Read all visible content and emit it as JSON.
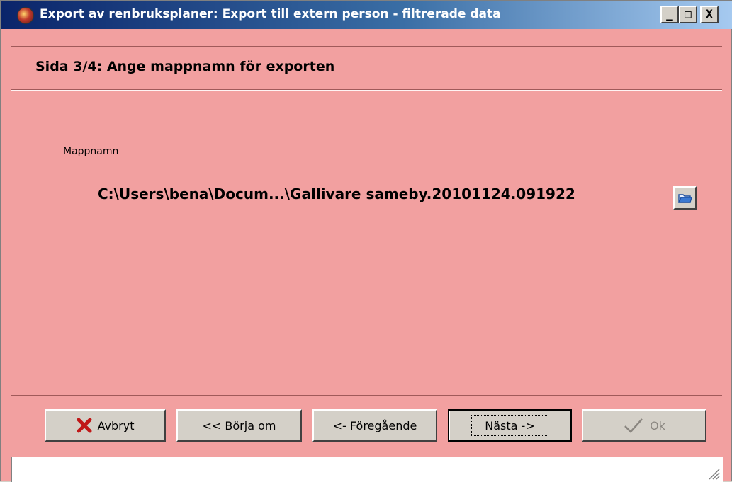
{
  "window": {
    "title": "Export av renbruksplaner: Export till extern person - filtrerade data",
    "controls": {
      "minimize": "_",
      "maximize": "□",
      "close": "X"
    },
    "icons": {
      "app": "app-icon"
    }
  },
  "page": {
    "title": "Sida 3/4: Ange mappnamn för exporten",
    "folder_label": "Mappnamn",
    "folder_path": "C:\\Users\\bena\\Docum...\\Gallivare sameby.20101124.091922"
  },
  "buttons": {
    "cancel": "Avbryt",
    "restart": "<< Börja om",
    "previous": "<- Föregående",
    "next": "Nästa ->",
    "ok": "Ok"
  },
  "colors": {
    "background": "#f2a0a0",
    "cancel_icon": "#c01818",
    "folder_icon": "#3a78d0"
  }
}
